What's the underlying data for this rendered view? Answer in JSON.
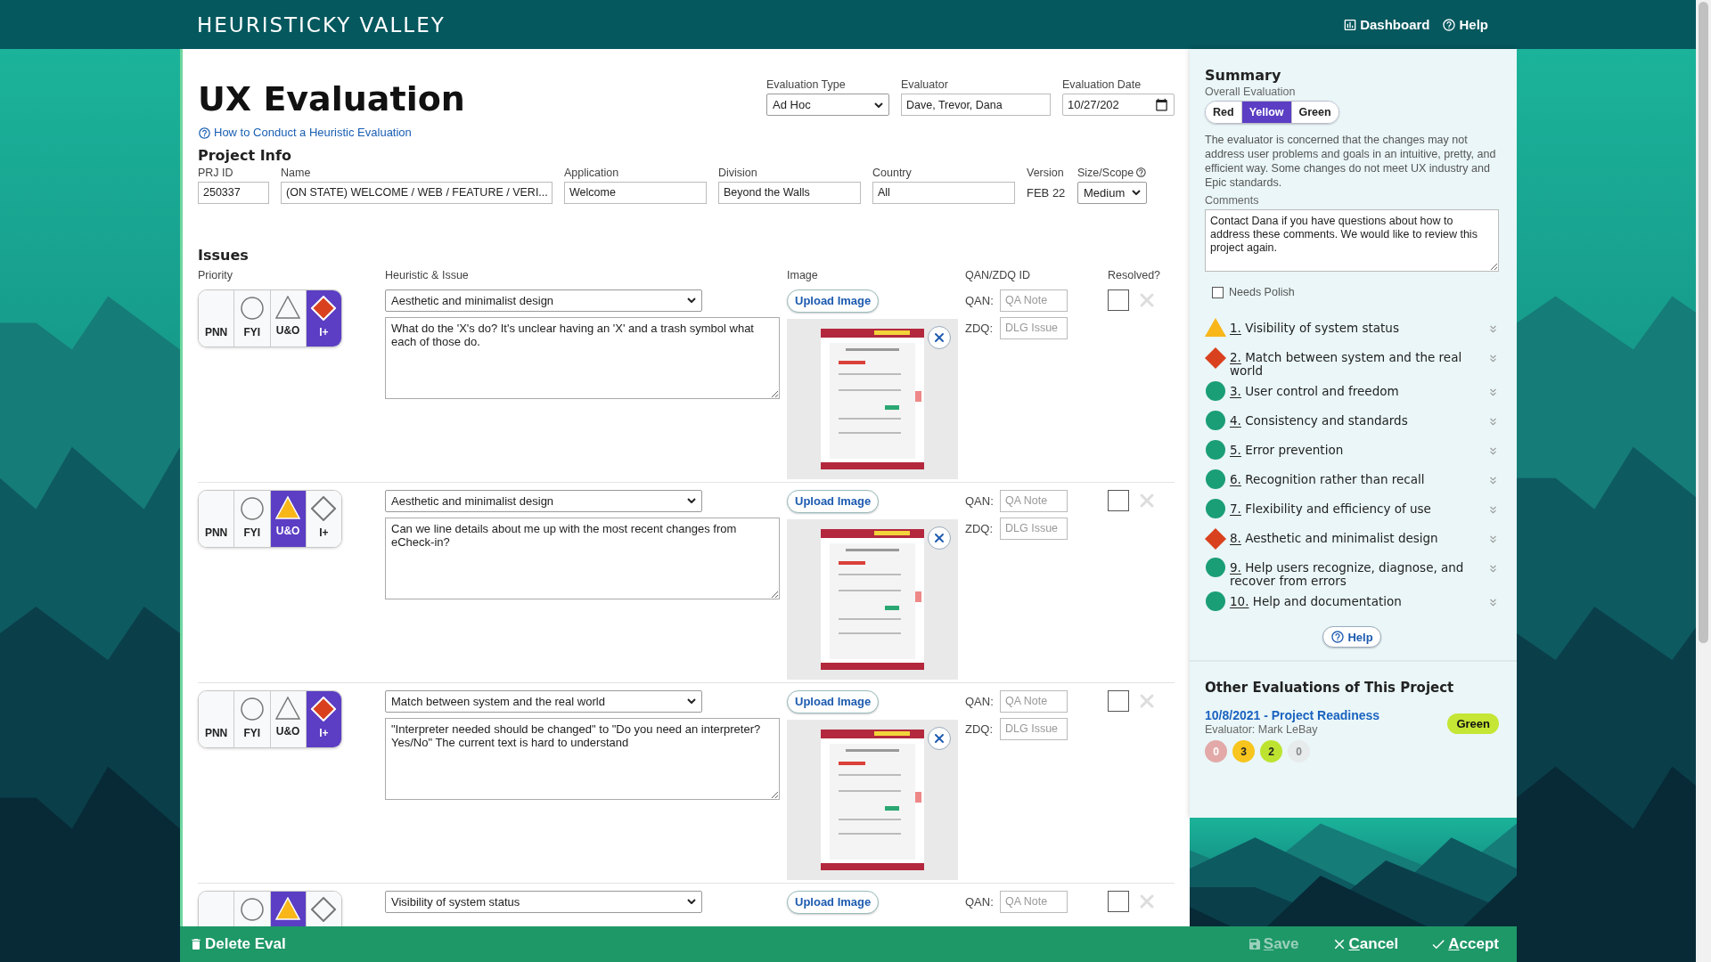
{
  "header": {
    "logo": "HEURISTICKY VALLEY",
    "nav": [
      {
        "label": "Dashboard"
      },
      {
        "label": "Help"
      }
    ]
  },
  "page": {
    "title": "UX Evaluation",
    "help_link": "How to Conduct a Heuristic Evaluation"
  },
  "evaluation_fields": [
    {
      "label": "Evaluation Type",
      "kind": "select",
      "value": "Ad Hoc"
    },
    {
      "label": "Evaluator",
      "kind": "text",
      "value": "Dave, Trevor, Dana"
    },
    {
      "label": "Evaluation Date",
      "kind": "date",
      "value": "10/27/202"
    }
  ],
  "project_info": {
    "title": "Project Info",
    "fields": [
      {
        "label": "PRJ ID",
        "kind": "text",
        "value": "250337"
      },
      {
        "label": "Name",
        "kind": "text",
        "value": "(ON STATE) WELCOME / WEB / FEATURE / VERI..."
      },
      {
        "label": "Application",
        "kind": "text",
        "value": "Welcome"
      },
      {
        "label": "Division",
        "kind": "text",
        "value": "Beyond the Walls"
      },
      {
        "label": "Country",
        "kind": "text",
        "value": "All"
      },
      {
        "label": "Version",
        "kind": "static",
        "value": "FEB 22"
      },
      {
        "label": "Size/Scope",
        "kind": "select",
        "value": "Medium",
        "help": true
      }
    ]
  },
  "issues": {
    "title": "Issues",
    "columns": [
      "Priority",
      "Heuristic & Issue",
      "Image",
      "QAN/ZDQ ID",
      "Resolved?"
    ],
    "rows": [
      {
        "priority": [
          {
            "label": "PNN",
            "selected": false
          },
          {
            "label": "FYI",
            "selected": false
          },
          {
            "label": "U&O",
            "selected": false
          },
          {
            "label": "I+",
            "selected": true
          }
        ],
        "heuristic": "Aesthetic and minimalist design",
        "issue": "What do the 'X's do? It's unclear having an 'X' and a trash symbol what each of those do.",
        "image_button": "Upload Image",
        "image": {
          "kind": "picture"
        },
        "qan_label": "QAN:",
        "qan_placeholder": "QA Note",
        "zdq_label": "ZDQ:",
        "zdq_placeholder": "DLG Issue",
        "resolved": false
      },
      {
        "priority": [
          {
            "label": "PNN",
            "selected": false
          },
          {
            "label": "FYI",
            "selected": false
          },
          {
            "label": "U&O",
            "selected": true
          },
          {
            "label": "I+",
            "selected": false
          }
        ],
        "heuristic": "Aesthetic and minimalist design",
        "issue": "Can we line details about me up with the most recent changes from eCheck-in?",
        "image_button": "Upload Image",
        "image": {
          "kind": "picture"
        },
        "qan_label": "QAN:",
        "qan_placeholder": "QA Note",
        "zdq_label": "ZDQ:",
        "zdq_placeholder": "DLG Issue",
        "resolved": false
      },
      {
        "priority": [
          {
            "label": "PNN",
            "selected": false
          },
          {
            "label": "FYI",
            "selected": false
          },
          {
            "label": "U&O",
            "selected": false
          },
          {
            "label": "I+",
            "selected": true
          }
        ],
        "heuristic": "Match between system and the real world",
        "issue": "\"Interpreter needed should be changed\" to \"Do you need an interpreter? Yes/No\" The current text is hard to understand",
        "image_button": "Upload Image",
        "image": {
          "kind": "picture"
        },
        "qan_label": "QAN:",
        "qan_placeholder": "QA Note",
        "zdq_label": "ZDQ:",
        "zdq_placeholder": "DLG Issue",
        "resolved": false
      },
      {
        "priority": [
          {
            "selected": false
          },
          {
            "selected": false
          },
          {
            "selected": true
          },
          {
            "selected": false
          }
        ],
        "heuristic": "Visibility of system status",
        "image_button": "Upload Image",
        "qan_label": "QAN:",
        "qan_placeholder": "QA Note",
        "resolved": false
      }
    ]
  },
  "summary": {
    "title": "Summary",
    "overall_label": "Overall Evaluation",
    "overall": [
      {
        "label": "Red",
        "selected": false
      },
      {
        "label": "Yellow",
        "selected": true
      },
      {
        "label": "Green",
        "selected": false
      }
    ],
    "description": "The evaluator is concerned that the changes may not address user problems and goals in an intuitive, pretty, and efficient way. Some changes do not meet UX industry and Epic standards.",
    "comments_label": "Comments",
    "comments": "Contact Dana if you have questions about how to address these comments. We would like to review this project again.",
    "needs_polish": {
      "label": "Needs Polish",
      "checked": false
    },
    "heuristics": [
      {
        "number": "1.",
        "label": "Visibility of system status",
        "kind": "warning"
      },
      {
        "number": "2.",
        "label": "Match between system and the real world",
        "kind": "critical"
      },
      {
        "number": "3.",
        "label": "User control and freedom",
        "kind": "ok"
      },
      {
        "number": "4.",
        "label": "Consistency and standards",
        "kind": "ok"
      },
      {
        "number": "5.",
        "label": "Error prevention",
        "kind": "ok"
      },
      {
        "number": "6.",
        "label": "Recognition rather than recall",
        "kind": "ok"
      },
      {
        "number": "7.",
        "label": "Flexibility and efficiency of use",
        "kind": "ok"
      },
      {
        "number": "8.",
        "label": "Aesthetic and minimalist design",
        "kind": "critical"
      },
      {
        "number": "9.",
        "label": "Help users recognize, diagnose, and recover from errors",
        "kind": "ok"
      },
      {
        "number": "10.",
        "label": "Help and documentation",
        "kind": "ok"
      }
    ],
    "help_button": "Help"
  },
  "other_evaluations": {
    "title": "Other Evaluations of This Project",
    "items": [
      {
        "link": "10/8/2021 - Project Readiness",
        "evaluator": "Evaluator: Mark LeBay",
        "rating": "Green",
        "color": "#c5e634",
        "counts": [
          {
            "value": "0",
            "color": "#e3a9a9"
          },
          {
            "value": "3",
            "color": "#f7c51e"
          },
          {
            "value": "2",
            "color": "#bde330"
          },
          {
            "value": "0",
            "color": "#e7ebeb"
          }
        ]
      }
    ]
  },
  "bottom_bar": {
    "left": [
      {
        "label": "Delete Eval",
        "disabled": false
      }
    ],
    "right": [
      {
        "label": "Save",
        "disabled": true
      },
      {
        "label": "Cancel",
        "disabled": false
      },
      {
        "label": "Accept",
        "disabled": false
      }
    ]
  }
}
